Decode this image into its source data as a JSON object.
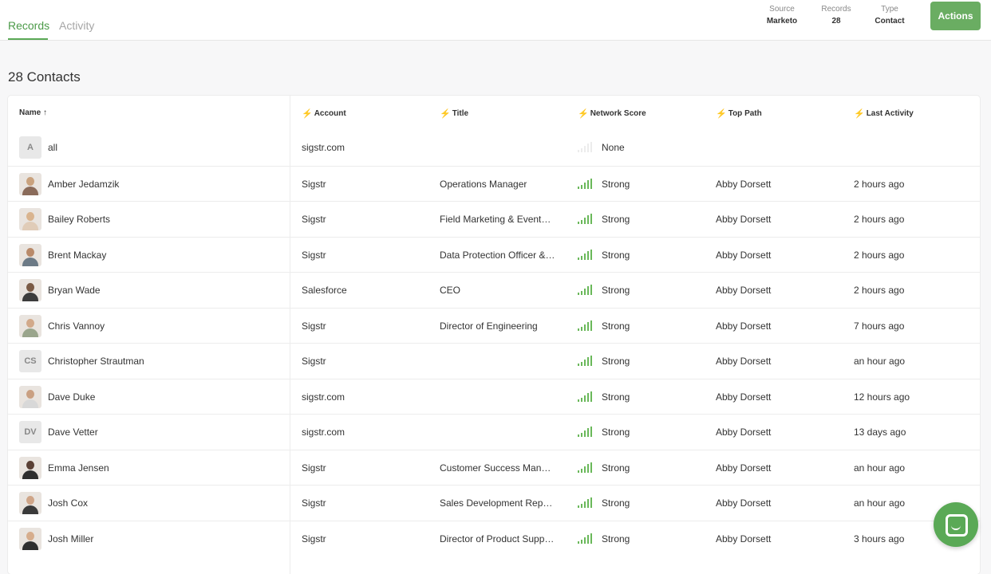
{
  "tabs": [
    {
      "label": "Records"
    },
    {
      "label": "Activity"
    }
  ],
  "meta": {
    "source": {
      "label": "Source",
      "value": "Marketo"
    },
    "records": {
      "label": "Records",
      "value": "28"
    },
    "type": {
      "label": "Type",
      "value": "Contact"
    }
  },
  "actions_label": "Actions",
  "heading": "28 Contacts",
  "columns": {
    "name": "Name ↑",
    "account": "Account",
    "title": "Title",
    "network_score": "Network Score",
    "top_path": "Top Path",
    "last_activity": "Last Activity"
  },
  "rows": [
    {
      "name": "all",
      "initials": "A",
      "account": "sigstr.com",
      "title": "",
      "score": "None",
      "top_path": "",
      "last_activity": ""
    },
    {
      "name": "Amber Jedamzik",
      "account": "Sigstr",
      "title": "Operations Manager",
      "score": "Strong",
      "top_path": "Abby Dorsett",
      "last_activity": "2 hours ago"
    },
    {
      "name": "Bailey Roberts",
      "account": "Sigstr",
      "title": "Field Marketing & Events…",
      "score": "Strong",
      "top_path": "Abby Dorsett",
      "last_activity": "2 hours ago"
    },
    {
      "name": "Brent Mackay",
      "account": "Sigstr",
      "title": "Data Protection Officer &…",
      "score": "Strong",
      "top_path": "Abby Dorsett",
      "last_activity": "2 hours ago"
    },
    {
      "name": "Bryan Wade",
      "account": "Salesforce",
      "title": "CEO",
      "score": "Strong",
      "top_path": "Abby Dorsett",
      "last_activity": "2 hours ago"
    },
    {
      "name": "Chris Vannoy",
      "account": "Sigstr",
      "title": "Director of Engineering",
      "score": "Strong",
      "top_path": "Abby Dorsett",
      "last_activity": "7 hours ago"
    },
    {
      "name": "Christopher Strautman",
      "initials": "CS",
      "account": "Sigstr",
      "title": "",
      "score": "Strong",
      "top_path": "Abby Dorsett",
      "last_activity": "an hour ago"
    },
    {
      "name": "Dave Duke",
      "account": "sigstr.com",
      "title": "",
      "score": "Strong",
      "top_path": "Abby Dorsett",
      "last_activity": "12 hours ago"
    },
    {
      "name": "Dave Vetter",
      "initials": "DV",
      "account": "sigstr.com",
      "title": "",
      "score": "Strong",
      "top_path": "Abby Dorsett",
      "last_activity": "13 days ago"
    },
    {
      "name": "Emma Jensen",
      "account": "Sigstr",
      "title": "Customer Success Mana…",
      "score": "Strong",
      "top_path": "Abby Dorsett",
      "last_activity": "an hour ago"
    },
    {
      "name": "Josh Cox",
      "account": "Sigstr",
      "title": "Sales Development Repr…",
      "score": "Strong",
      "top_path": "Abby Dorsett",
      "last_activity": "an hour ago"
    },
    {
      "name": "Josh Miller",
      "account": "Sigstr",
      "title": "Director of Product Supp…",
      "score": "Strong",
      "top_path": "Abby Dorsett",
      "last_activity": "3 hours ago"
    }
  ],
  "colors": {
    "accent": "#5aa956",
    "signal_strong": "#6ab85a",
    "bolt": "#5b7de6"
  }
}
